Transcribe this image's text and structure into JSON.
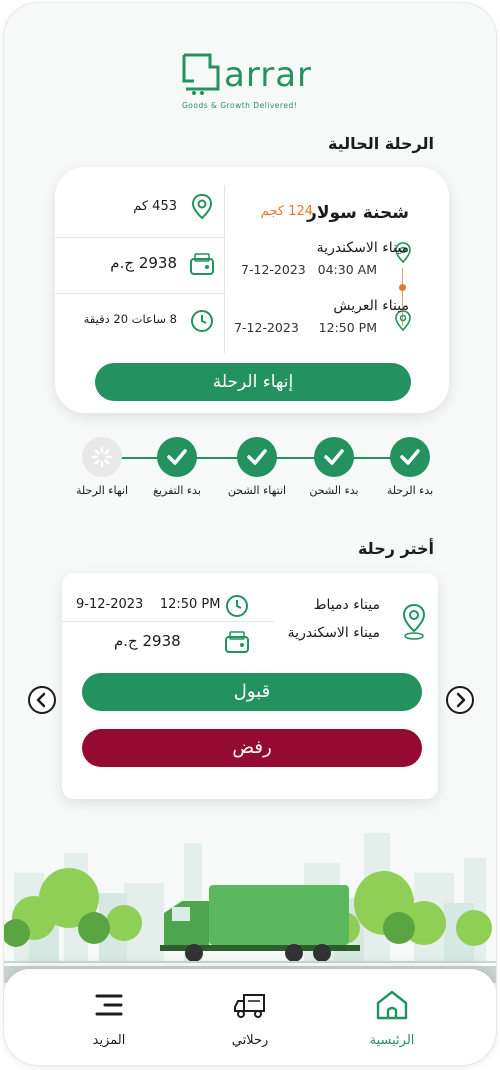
{
  "brand": {
    "name": "arrar",
    "tagline": "Goods & Growth Delivered!",
    "color": "#23925f"
  },
  "current_trip": {
    "section_title": "الرحلة الحالية",
    "shipment_title": "شحنة سولار",
    "weight": "124 كجم",
    "origin": {
      "port": "ميناء الاسكندرية",
      "date": "7-12-2023",
      "time": "04:30 AM"
    },
    "destination": {
      "port": "ميناء العريش",
      "date": "7-12-2023",
      "time": "12:50 PM"
    },
    "distance": "453 كم",
    "price": "2938 ج.م",
    "duration": "8 ساعات 20 دقيقة",
    "end_button": "إنهاء الرحلة"
  },
  "progress_steps": [
    {
      "label": "بدء الرحلة",
      "done": true
    },
    {
      "label": "بدء الشحن",
      "done": true
    },
    {
      "label": "انتهاء الشحن",
      "done": true
    },
    {
      "label": "بدء التفريغ",
      "done": true
    },
    {
      "label": "انهاء الرحلة",
      "done": false
    }
  ],
  "choose_trip": {
    "section_title": "أختر رحلة",
    "from_port": "ميناء دمياط",
    "to_port": "ميناء الاسكندرية",
    "date": "9-12-2023",
    "time": "12:50 PM",
    "price": "2938 ج.م",
    "accept_button": "قبول",
    "reject_button": "رفض",
    "accept_color": "#23925f",
    "reject_color": "#950a33"
  },
  "bottom_nav": {
    "home": "الرئيسية",
    "my_trips": "رحلاتي",
    "more": "المزيد"
  },
  "colors": {
    "accent": "#23925f",
    "orange": "#e9772b"
  }
}
